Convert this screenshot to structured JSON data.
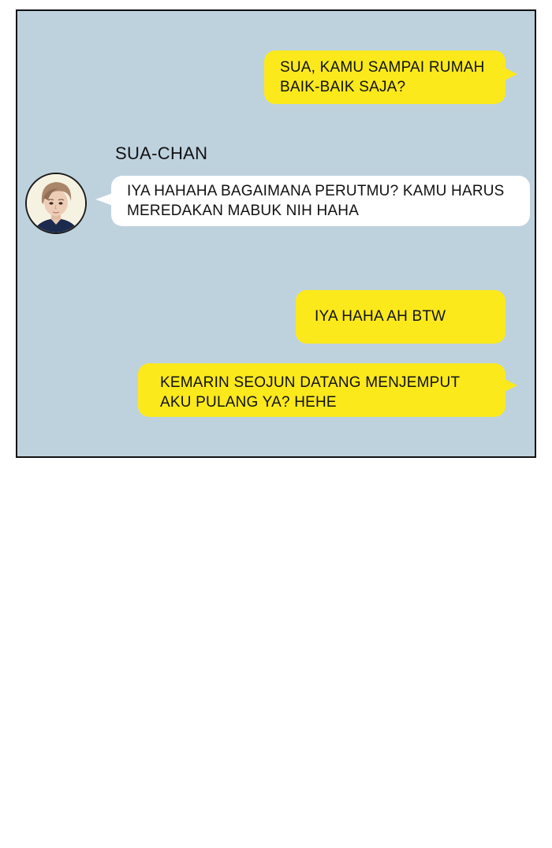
{
  "chat": {
    "messages": [
      {
        "side": "right",
        "text_line1": "SUA, KAMU SAMPAI RUMAH",
        "text_line2": "BAIK-BAIK SAJA?"
      },
      {
        "side": "left",
        "sender": "SUA-CHAN",
        "text_line1": "IYA HAHAHA BAGAIMANA PERUTMU? KAMU HARUS",
        "text_line2": "MEREDAKAN MABUK NIH HAHA"
      },
      {
        "side": "right",
        "text_line1": "IYA HAHA AH BTW"
      },
      {
        "side": "right",
        "text_line1": "KEMARIN SEOJUN DATANG MENJEMPUT",
        "text_line2": "AKU PULANG YA? HEHE"
      }
    ]
  },
  "colors": {
    "panel_background": "#bed2de",
    "my_bubble": "#fbe91c",
    "their_bubble": "#ffffff",
    "border": "#111111"
  }
}
